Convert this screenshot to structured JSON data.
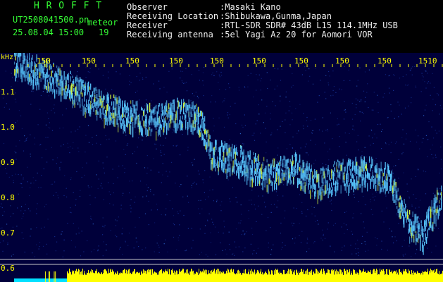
{
  "header": {
    "app_title": "H R O F F T",
    "file_name": "UT2508041500.pn",
    "tag": "meteor",
    "datetime": "25.08.04 15:00",
    "count": "19",
    "labels": {
      "observer": "Observer",
      "location": "Receiving Location",
      "receiver": "Receiver",
      "antenna": "Receiving antenna"
    },
    "values": {
      "observer": ":Masaki Kano",
      "location": ":Shibukawa,Gunma,Japan",
      "receiver": ":RTL-SDR SDR# 43dB L15 114.1MHz USB",
      "antenna": ":5el Yagi Az 20 for Aomori VOR"
    }
  },
  "spectrogram": {
    "y_unit": "kHz",
    "y_ticks": [
      "1.1",
      "1.0",
      "0.9",
      "0.8",
      "0.7",
      "0.6"
    ],
    "x_ticks": [
      "150",
      "150",
      "150",
      "150",
      "150",
      "150",
      "150",
      "150",
      "150",
      "1510"
    ],
    "colors": {
      "background": "#00003a",
      "signal": "#58c8ff",
      "peak": "#d8ff40",
      "power_bar": "#ffff00",
      "power_baseline": "#00e0ff",
      "axis_text": "#ffff00"
    }
  }
}
